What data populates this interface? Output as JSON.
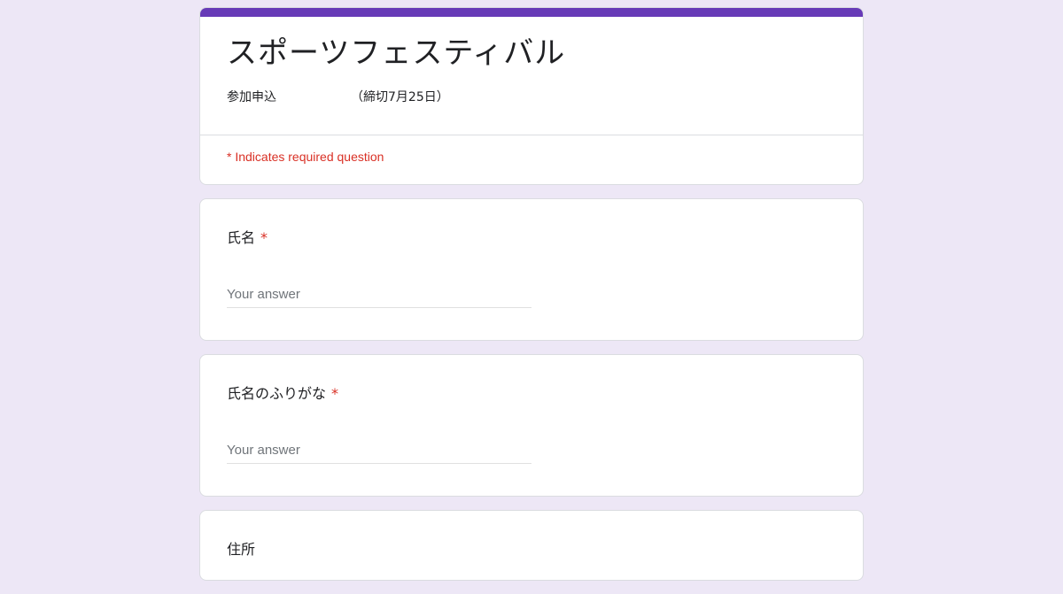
{
  "colors": {
    "accent": "#673ab7",
    "background": "#ede7f6",
    "required": "#d93025"
  },
  "header": {
    "title": "スポーツフェスティバル",
    "description_left": "参加申込",
    "description_right": "（締切7月25日）",
    "required_note": "* Indicates required question"
  },
  "questions": [
    {
      "label": "氏名",
      "required_mark": "*",
      "placeholder": "Your answer"
    },
    {
      "label": "氏名のふりがな",
      "required_mark": "*",
      "placeholder": "Your answer"
    },
    {
      "label": "住所"
    }
  ]
}
